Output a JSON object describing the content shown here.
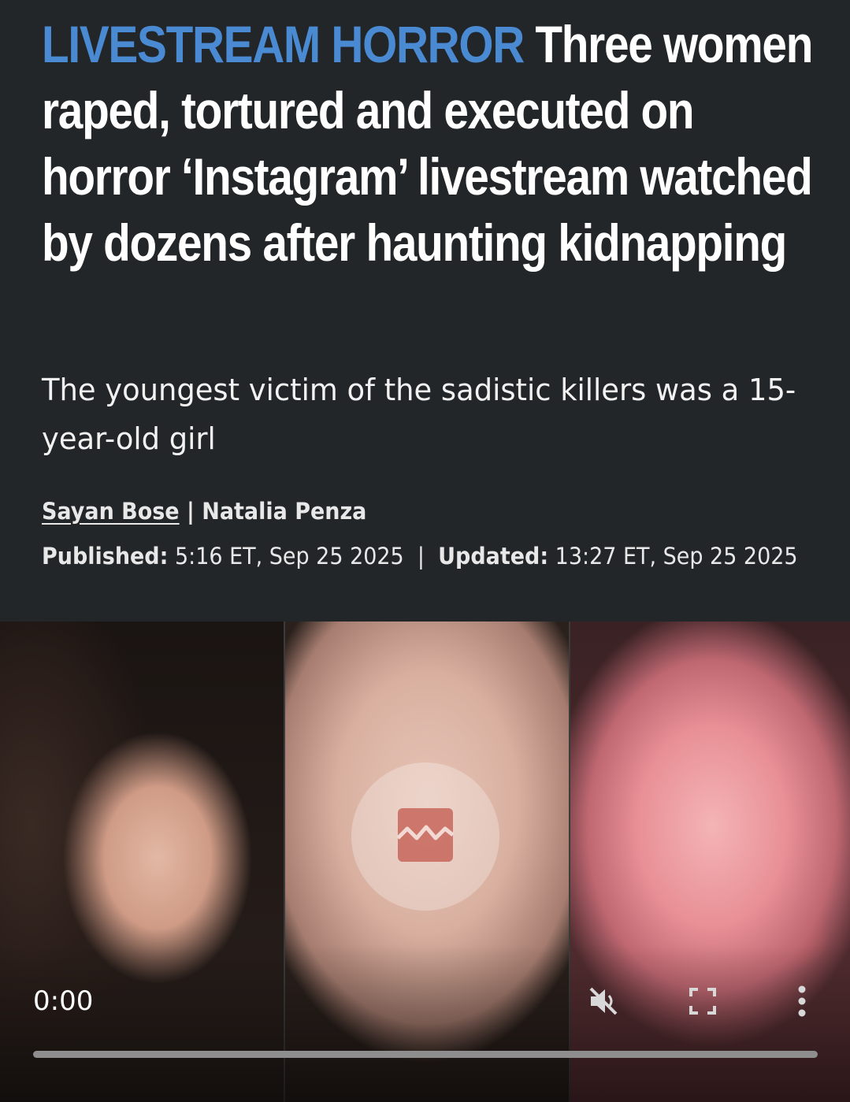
{
  "article": {
    "kicker": "LIVESTREAM HORROR",
    "headline": " Three women raped, tortured and executed on horror ‘Instagram’ livestream watched by dozens after haunting kidnapping",
    "standfirst": "The youngest victim of the sadistic killers was a 15-year-old girl",
    "authors": [
      "Sayan Bose",
      "Natalia Penza"
    ],
    "byline_separator": " | ",
    "published_label": "Published:",
    "published_value": " 5:16 ET, Sep 25 2025",
    "dates_separator": "  |  ",
    "updated_label": "Updated:",
    "updated_value": " 13:27 ET, Sep 25 2025"
  },
  "colors": {
    "kicker": "#4a8ad3",
    "background": "#222628",
    "text": "#ffffff"
  },
  "video": {
    "center_icon": "broken-image-icon",
    "time": "0:00",
    "progress": 0,
    "controls": {
      "mute_icon": "volume-muted-icon",
      "fullscreen_icon": "fullscreen-icon",
      "more_icon": "more-vertical-icon"
    }
  }
}
